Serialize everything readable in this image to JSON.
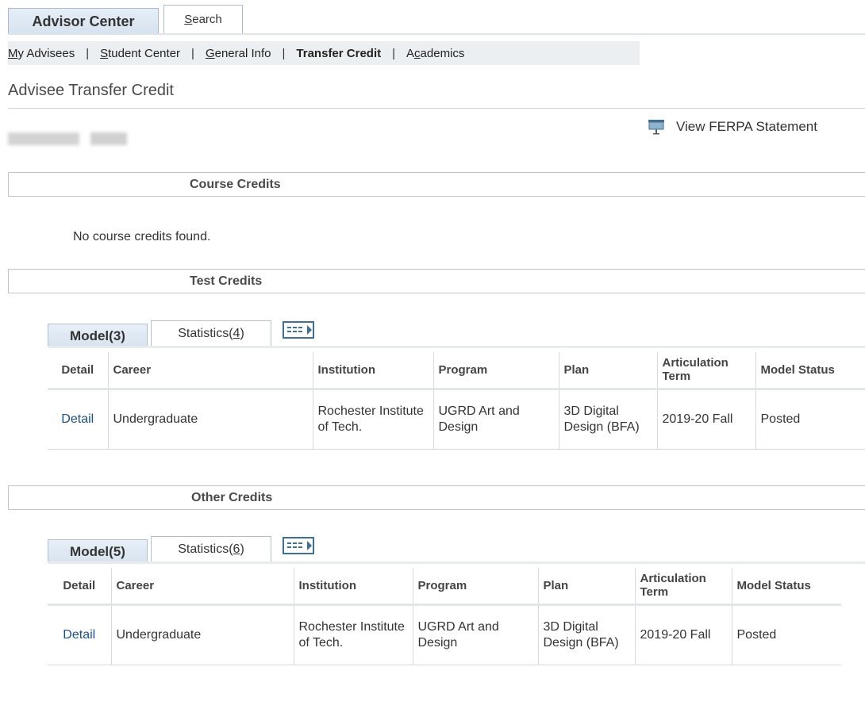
{
  "top_tabs": {
    "advisor_center": "Advisor Center",
    "search": {
      "underlined": "S",
      "rest": "earch"
    }
  },
  "subnav": {
    "items": [
      {
        "underlined": "M",
        "rest": "y Advisees"
      },
      {
        "underlined": "S",
        "rest": "tudent Center"
      },
      {
        "underlined": "G",
        "rest": "eneral Info"
      },
      {
        "label": "Transfer Credit",
        "active": true
      },
      {
        "before": "A",
        "underlined": "c",
        "rest": "ademics"
      }
    ],
    "separator": "|"
  },
  "page_title": "Advisee Transfer Credit",
  "ferpa_link": "View FERPA Statement",
  "sections": {
    "course_credits": {
      "title": "Course Credits",
      "empty_message": "No course credits found."
    },
    "test_credits": {
      "title": "Test Credits",
      "tab_active": "Model(3)",
      "tab_other": {
        "prefix": "Statistics(",
        "underlined": "4",
        "suffix": ")"
      },
      "headers": [
        "Detail",
        "Career",
        "Institution",
        "Program",
        "Plan",
        "Articulation Term",
        "Model Status"
      ],
      "rows": [
        {
          "detail": "Detail",
          "career": "Undergraduate",
          "institution": "Rochester Institute of Tech.",
          "program": "UGRD Art and Design",
          "plan": "3D Digital Design (BFA)",
          "term": "2019-20 Fall",
          "status": "Posted"
        }
      ]
    },
    "other_credits": {
      "title": "Other Credits",
      "tab_active": "Model(5)",
      "tab_other": {
        "prefix": "Statistics(",
        "underlined": "6",
        "suffix": ")"
      },
      "headers": [
        "Detail",
        "Career",
        "Institution",
        "Program",
        "Plan",
        "Articulation Term",
        "Model Status"
      ],
      "rows": [
        {
          "detail": "Detail",
          "career": "Undergraduate",
          "institution": "Rochester Institute of Tech.",
          "program": "UGRD Art and Design",
          "plan": "3D Digital Design (BFA)",
          "term": "2019-20 Fall",
          "status": "Posted"
        }
      ]
    }
  },
  "colors": {
    "link": "#1a4f8b",
    "tab_bg": "#d7e3ef",
    "subnav_bg": "#eceff2"
  },
  "icons": {
    "ferpa": "presentation-board-icon",
    "grid_toggle": "show-all-columns-icon"
  }
}
